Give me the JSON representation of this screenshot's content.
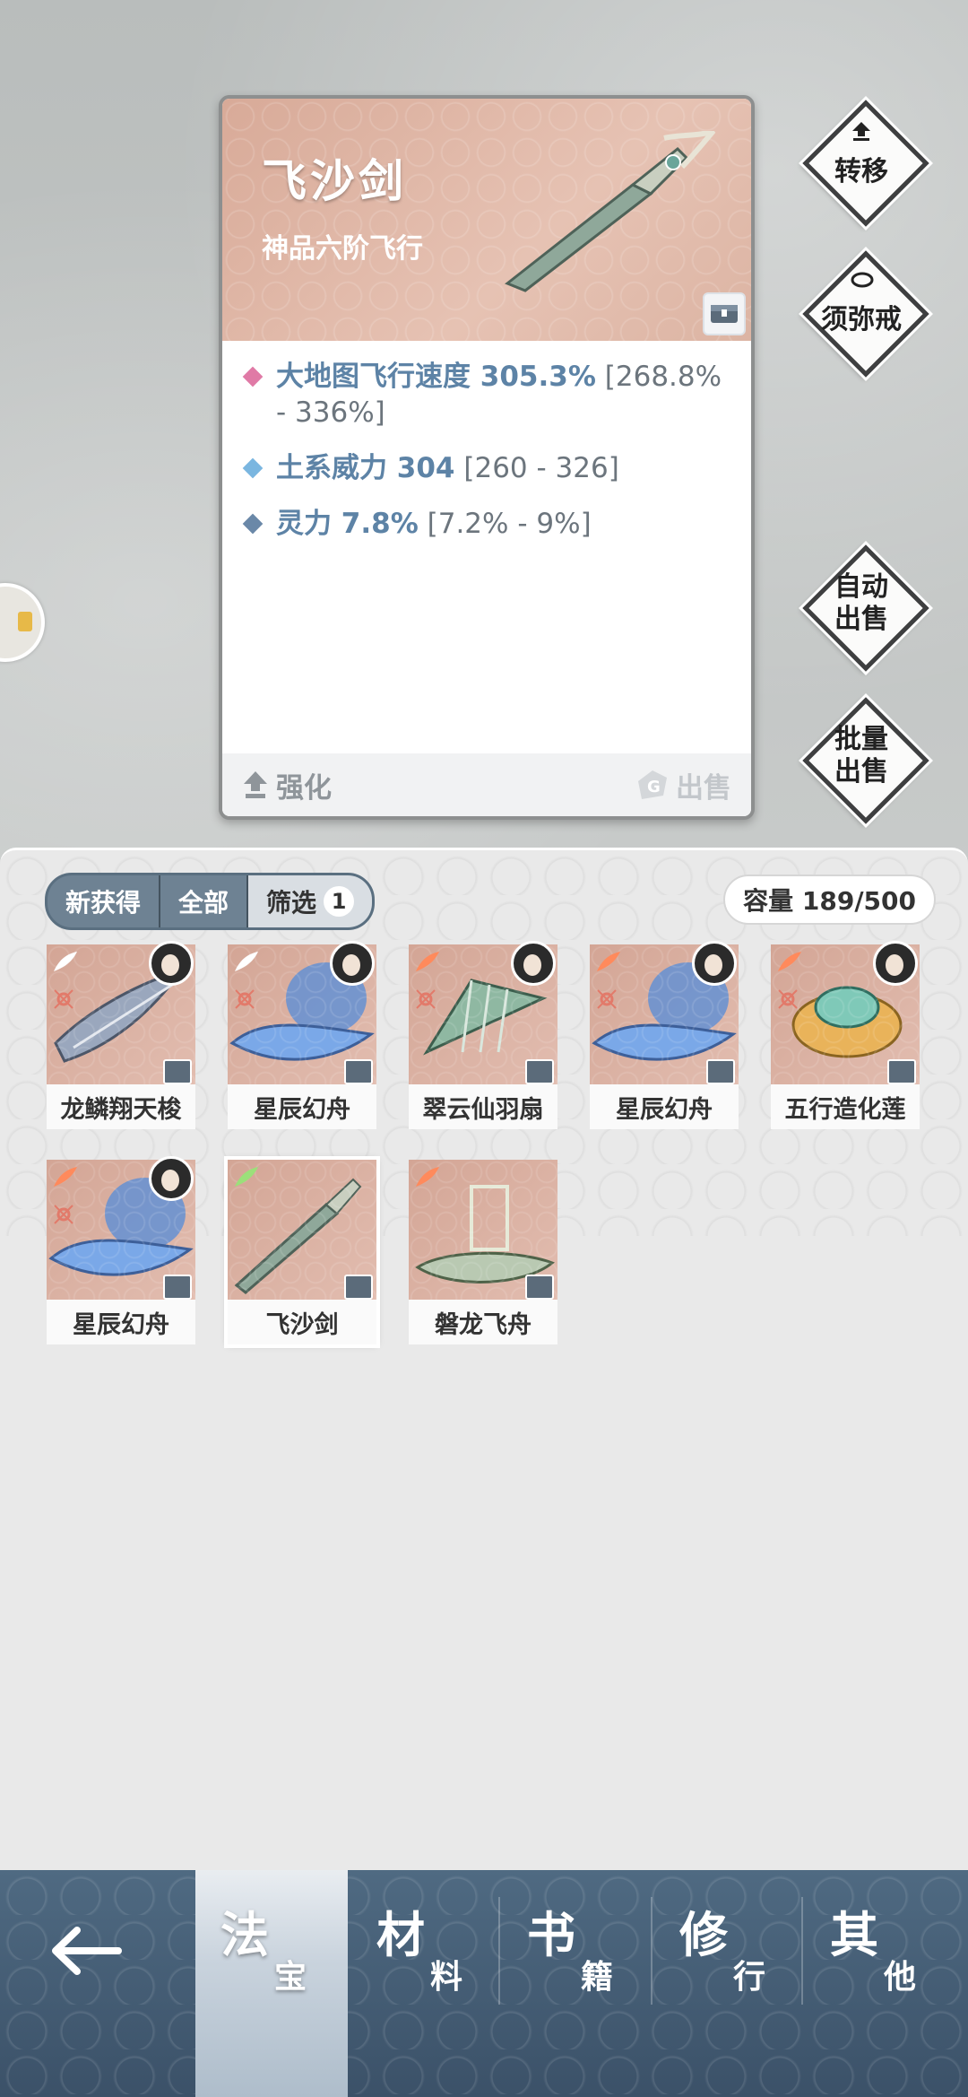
{
  "detail": {
    "name": "飞沙剑",
    "grade": "神品六阶飞行",
    "stats": [
      {
        "name": "大地图飞行速度 305.3%",
        "range": "[268.8% - 336%]",
        "color": "#e07aa6"
      },
      {
        "name": "土系威力 304",
        "range": "[260 - 326]",
        "color": "#7ab6e0"
      },
      {
        "name": "灵力 7.8%",
        "range": "[7.2% - 9%]",
        "color": "#6a88a8"
      }
    ],
    "enhance_label": "强化",
    "sell_label": "出售"
  },
  "side_buttons": {
    "transfer": "转移",
    "ring": "须弥戒",
    "auto_sell_1": "自动",
    "auto_sell_2": "出售",
    "batch_sell_1": "批量",
    "batch_sell_2": "出售"
  },
  "filter": {
    "tabs": [
      "新获得",
      "全部",
      "筛选"
    ],
    "badge": "1"
  },
  "capacity": "容量 189/500",
  "items": [
    {
      "label": "龙鳞翔天梭"
    },
    {
      "label": "星辰幻舟"
    },
    {
      "label": "翠云仙羽扇"
    },
    {
      "label": "星辰幻舟"
    },
    {
      "label": "五行造化莲"
    },
    {
      "label": "星辰幻舟"
    },
    {
      "label": "飞沙剑"
    },
    {
      "label": "磐龙飞舟"
    }
  ],
  "nav": [
    {
      "big": "法",
      "small": "宝"
    },
    {
      "big": "材",
      "small": "料"
    },
    {
      "big": "书",
      "small": "籍"
    },
    {
      "big": "修",
      "small": "行"
    },
    {
      "big": "其",
      "small": "他"
    }
  ],
  "colors": {
    "accent": "#5d83a6",
    "card_head": "#dcae9c",
    "nav_bg": "#46607a"
  }
}
